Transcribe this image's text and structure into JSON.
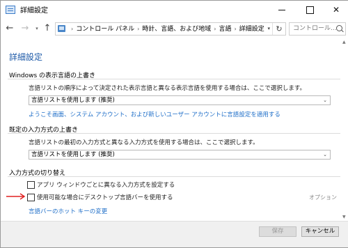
{
  "window": {
    "title": "詳細設定",
    "minimize_glyph": "",
    "maximize_glyph": "",
    "close_glyph": "✕"
  },
  "nav": {
    "back_glyph": "←",
    "forward_glyph": "→",
    "recent_glyph": "▾",
    "up_glyph": "↑",
    "breadcrumb": [
      "コントロール パネル",
      "時計、言語、および地域",
      "言語",
      "詳細設定"
    ],
    "separator_glyph": "›",
    "address_dropdown_glyph": "▾",
    "refresh_glyph": "↻",
    "search_placeholder": "コントロール..."
  },
  "page": {
    "title": "詳細設定",
    "sections": [
      {
        "title": "Windows の表示言語の上書き",
        "description": "言語リストの順序によって決定された表示言語と異なる表示言語を使用する場合は、ここで選択します。",
        "select_value": "言語リストを使用します (推奨)",
        "link": "ようこそ画面、システム アカウント、および新しいユーザー アカウントに言語設定を適用する"
      },
      {
        "title": "既定の入力方式の上書き",
        "description": "言語リストの最初の入力方式と異なる入力方式を使用する場合は、ここで選択します。",
        "select_value": "言語リストを使用します (推奨)"
      },
      {
        "title": "入力方式の切り替え",
        "checkboxes": [
          {
            "label": "アプリ ウィンドウごとに異なる入力方式を設定する",
            "checked": false
          },
          {
            "label": "使用可能な場合にデスクトップ言語バーを使用する",
            "checked": false
          }
        ],
        "options_label": "オプション",
        "link": "言語バーのホット キーの変更"
      }
    ]
  },
  "select_arrow_glyph": "⌄",
  "footer": {
    "save_label": "保存",
    "cancel_label": "キャンセル"
  },
  "scrollbar": {
    "up_glyph": "▲",
    "down_glyph": "▼"
  },
  "colors": {
    "accent_title": "#1e5aa8",
    "link": "#1e6ec8",
    "annotation_arrow": "#e02020"
  }
}
